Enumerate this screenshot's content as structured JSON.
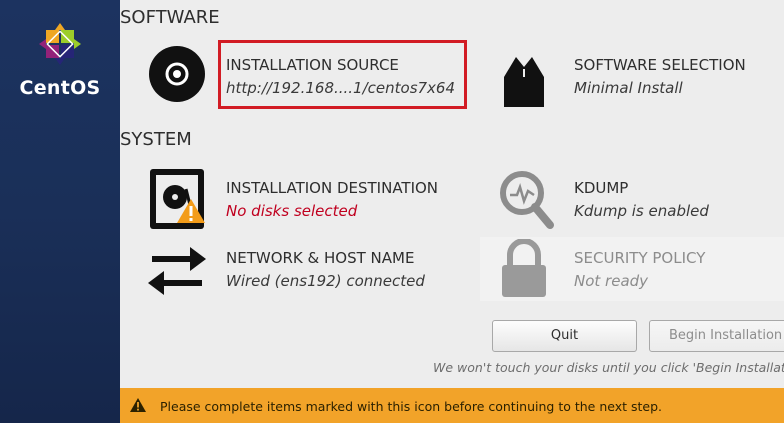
{
  "brand": {
    "name": "CentOS"
  },
  "sections": {
    "software": "SOFTWARE",
    "system": "SYSTEM"
  },
  "spokes": {
    "installation_source": {
      "title": "INSTALLATION SOURCE",
      "status": "http://192.168....1/centos7x64",
      "icon": "disc-icon"
    },
    "software_selection": {
      "title": "SOFTWARE SELECTION",
      "status": "Minimal Install",
      "icon": "package-icon"
    },
    "installation_destination": {
      "title": "INSTALLATION DESTINATION",
      "status": "No disks selected",
      "icon": "harddisk-icon"
    },
    "kdump": {
      "title": "KDUMP",
      "status": "Kdump is enabled",
      "icon": "magnifier-icon"
    },
    "network": {
      "title": "NETWORK & HOST NAME",
      "status": "Wired (ens192) connected",
      "icon": "network-arrows-icon"
    },
    "security_policy": {
      "title": "SECURITY POLICY",
      "status": "Not ready",
      "icon": "padlock-icon"
    }
  },
  "buttons": {
    "quit": "Quit",
    "begin_installation": "Begin Installation"
  },
  "note": "We won't touch your disks until you click 'Begin Installation'.",
  "warning": {
    "text": "Please complete items marked with this icon before continuing to the next step.",
    "color": "#f2a329"
  },
  "colors": {
    "sidebar": "#1c3360",
    "error": "#c0001f",
    "highlight": "#d21c24"
  }
}
